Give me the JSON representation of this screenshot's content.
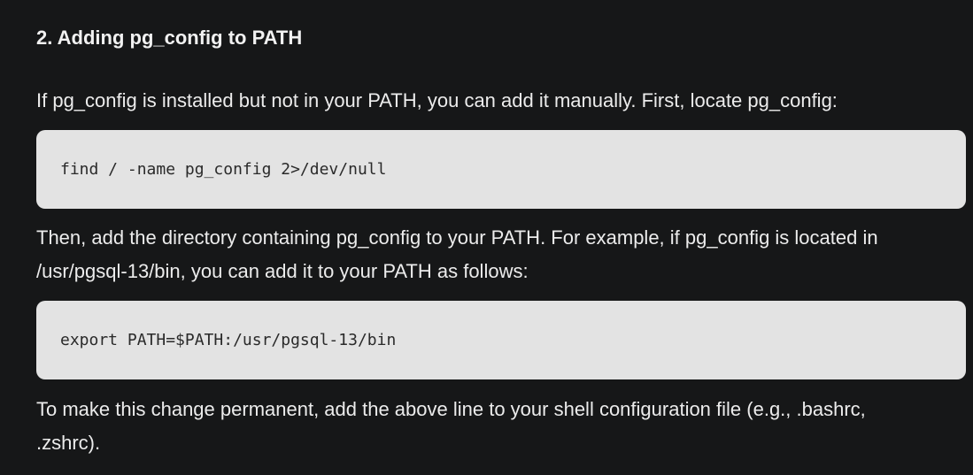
{
  "section": {
    "heading": "2. Adding pg_config to PATH",
    "intro": "If pg_config is installed but not in your PATH, you can add it manually. First, locate pg_config:",
    "code_find": "find / -name pg_config 2>/dev/null",
    "explain": "Then, add the directory containing pg_config to your PATH. For example, if pg_config is located in /usr/pgsql-13/bin, you can add it to your PATH as follows:",
    "code_export": "export PATH=$PATH:/usr/pgsql-13/bin",
    "outro": "To make this change permanent, add the above line to your shell configuration file (e.g., .bashrc, .zshrc)."
  },
  "colors": {
    "background": "#161718",
    "text": "#ececec",
    "code_background": "#e3e3e3",
    "code_text": "#2a2a2a"
  }
}
